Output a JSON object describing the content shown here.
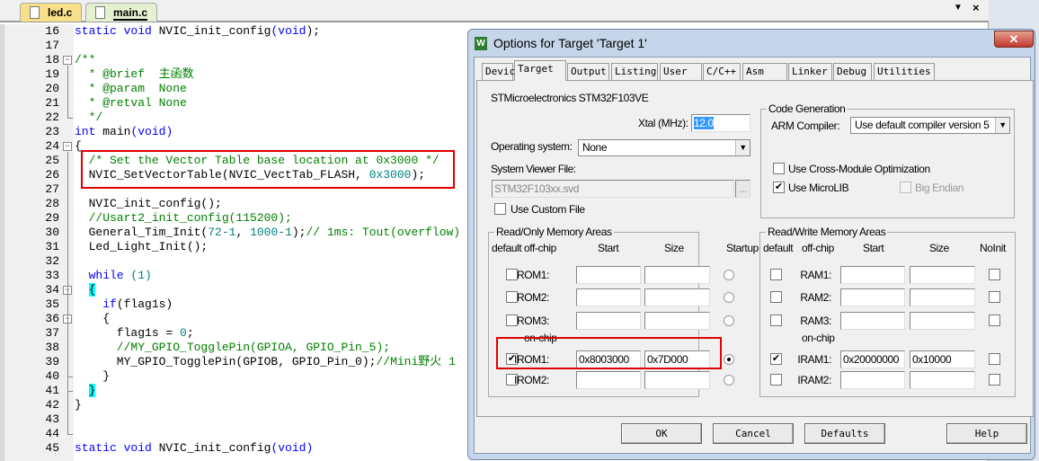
{
  "editor": {
    "tabs": [
      {
        "label": "led.c",
        "active": false
      },
      {
        "label": "main.c",
        "active": true
      }
    ],
    "lines": [
      {
        "n": "16",
        "seg": [
          [
            "kw",
            "static void "
          ],
          [
            "tx",
            "NVIC_init_config"
          ],
          [
            "kw",
            "("
          ],
          [
            "kw",
            "void"
          ],
          [
            "tx",
            ");"
          ]
        ]
      },
      {
        "n": "17",
        "seg": []
      },
      {
        "n": "18",
        "seg": [
          [
            "cm",
            "/**"
          ]
        ],
        "fold": "minus"
      },
      {
        "n": "19",
        "seg": [
          [
            "cm",
            "  * @brief  主函数"
          ]
        ]
      },
      {
        "n": "20",
        "seg": [
          [
            "cm",
            "  * @param  None"
          ]
        ]
      },
      {
        "n": "21",
        "seg": [
          [
            "cm",
            "  * @retval None"
          ]
        ]
      },
      {
        "n": "22",
        "seg": [
          [
            "cm",
            "  */"
          ]
        ]
      },
      {
        "n": "23",
        "seg": [
          [
            "kw",
            "int "
          ],
          [
            "tx",
            "main"
          ],
          [
            "kw",
            "(void)"
          ]
        ]
      },
      {
        "n": "24",
        "seg": [
          [
            "tx",
            "{"
          ]
        ],
        "fold": "minus"
      },
      {
        "n": "25",
        "seg": [
          [
            "cm",
            "  /* Set the Vector Table base location at 0x3000 */"
          ]
        ]
      },
      {
        "n": "26",
        "seg": [
          [
            "tx",
            "  NVIC_SetVectorTable(NVIC_VectTab_FLASH, "
          ],
          [
            "num",
            "0x3000"
          ],
          [
            "tx",
            ");"
          ]
        ]
      },
      {
        "n": "27",
        "seg": []
      },
      {
        "n": "28",
        "seg": [
          [
            "tx",
            "  NVIC_init_config();"
          ]
        ]
      },
      {
        "n": "29",
        "seg": [
          [
            "cm",
            "  //Usart2_init_config(115200);"
          ]
        ]
      },
      {
        "n": "30",
        "seg": [
          [
            "tx",
            "  General_Tim_Init("
          ],
          [
            "num",
            "72-1"
          ],
          [
            "tx",
            ", "
          ],
          [
            "num",
            "1000-1"
          ],
          [
            "tx",
            ");"
          ],
          [
            "cm",
            "// 1ms: Tout(overflow)"
          ]
        ]
      },
      {
        "n": "31",
        "seg": [
          [
            "tx",
            "  Led_Light_Init();"
          ]
        ]
      },
      {
        "n": "32",
        "seg": []
      },
      {
        "n": "33",
        "seg": [
          [
            "kw",
            "  while "
          ],
          [
            "num",
            "(1)"
          ]
        ]
      },
      {
        "n": "34",
        "seg": [
          [
            "tx",
            "  "
          ],
          [
            "br",
            "{"
          ]
        ],
        "fold": "minus"
      },
      {
        "n": "35",
        "seg": [
          [
            "kw",
            "    if"
          ],
          [
            "tx",
            "(flag1s)"
          ]
        ]
      },
      {
        "n": "36",
        "seg": [
          [
            "tx",
            "    {"
          ]
        ],
        "fold": "minus"
      },
      {
        "n": "37",
        "seg": [
          [
            "tx",
            "      flag1s = "
          ],
          [
            "num",
            "0"
          ],
          [
            "tx",
            ";"
          ]
        ]
      },
      {
        "n": "38",
        "seg": [
          [
            "cm",
            "      //MY_GPIO_TogglePin(GPIOA, GPIO_Pin_5);"
          ]
        ]
      },
      {
        "n": "39",
        "seg": [
          [
            "tx",
            "      MY_GPIO_TogglePin(GPIOB, GPIO_Pin_0);"
          ],
          [
            "cm",
            "//Mini野火 1"
          ]
        ]
      },
      {
        "n": "40",
        "seg": [
          [
            "tx",
            "    }"
          ]
        ]
      },
      {
        "n": "41",
        "seg": [
          [
            "tx",
            "  "
          ],
          [
            "br",
            "}"
          ]
        ]
      },
      {
        "n": "42",
        "seg": [
          [
            "tx",
            "}"
          ]
        ]
      },
      {
        "n": "43",
        "seg": []
      },
      {
        "n": "44",
        "seg": []
      },
      {
        "n": "45",
        "seg": [
          [
            "kw",
            "static void "
          ],
          [
            "tx",
            "NVIC_init_config"
          ],
          [
            "kw",
            "(void)"
          ]
        ]
      }
    ]
  },
  "dialog": {
    "title": "Options for Target 'Target 1'",
    "close": "✕",
    "tabs": [
      "Device",
      "Target",
      "Output",
      "Listing",
      "User",
      "C/C++",
      "Asm",
      "Linker",
      "Debug",
      "Utilities"
    ],
    "active_tab": "Target",
    "device": "STMicroelectronics STM32F103VE",
    "xtal_label": "Xtal (MHz):",
    "xtal": "12.0",
    "os_label": "Operating system:",
    "os": "None",
    "svf_label": "System Viewer File:",
    "svf": "STM32F103xx.svd",
    "browse": "...",
    "custom_file": "Use Custom File",
    "codegen": {
      "title": "Code Generation",
      "compiler_label": "ARM Compiler:",
      "compiler": "Use default compiler version 5",
      "cross_module": "Use Cross-Module Optimization",
      "cross_module_checked": false,
      "microlib": "Use MicroLIB",
      "microlib_checked": true,
      "big_endian": "Big Endian",
      "big_endian_checked": false
    },
    "ro": {
      "title": "Read/Only Memory Areas",
      "headers": [
        "default",
        "off-chip",
        "Start",
        "Size",
        "Startup"
      ],
      "onchip": "on-chip",
      "rows": [
        {
          "name": "ROM1:",
          "start": "",
          "size": "",
          "def": false,
          "startup": false
        },
        {
          "name": "ROM2:",
          "start": "",
          "size": "",
          "def": false,
          "startup": false
        },
        {
          "name": "ROM3:",
          "start": "",
          "size": "",
          "def": false,
          "startup": false
        },
        {
          "name": "IROM1:",
          "start": "0x8003000",
          "size": "0x7D000",
          "def": true,
          "startup": true
        },
        {
          "name": "IROM2:",
          "start": "",
          "size": "",
          "def": false,
          "startup": false
        }
      ]
    },
    "rw": {
      "title": "Read/Write Memory Areas",
      "headers": [
        "default",
        "off-chip",
        "Start",
        "Size",
        "NoInit"
      ],
      "onchip": "on-chip",
      "rows": [
        {
          "name": "RAM1:",
          "start": "",
          "size": "",
          "def": false,
          "noinit": false
        },
        {
          "name": "RAM2:",
          "start": "",
          "size": "",
          "def": false,
          "noinit": false
        },
        {
          "name": "RAM3:",
          "start": "",
          "size": "",
          "def": false,
          "noinit": false
        },
        {
          "name": "IRAM1:",
          "start": "0x20000000",
          "size": "0x10000",
          "def": true,
          "noinit": false
        },
        {
          "name": "IRAM2:",
          "start": "",
          "size": "",
          "def": false,
          "noinit": false
        }
      ]
    },
    "buttons": {
      "ok": "OK",
      "cancel": "Cancel",
      "defaults": "Defaults",
      "help": "Help"
    }
  },
  "colors": {
    "highlight_box": "#e00000",
    "keyword": "#0000ff",
    "comment": "#008000",
    "number": "#008080"
  }
}
